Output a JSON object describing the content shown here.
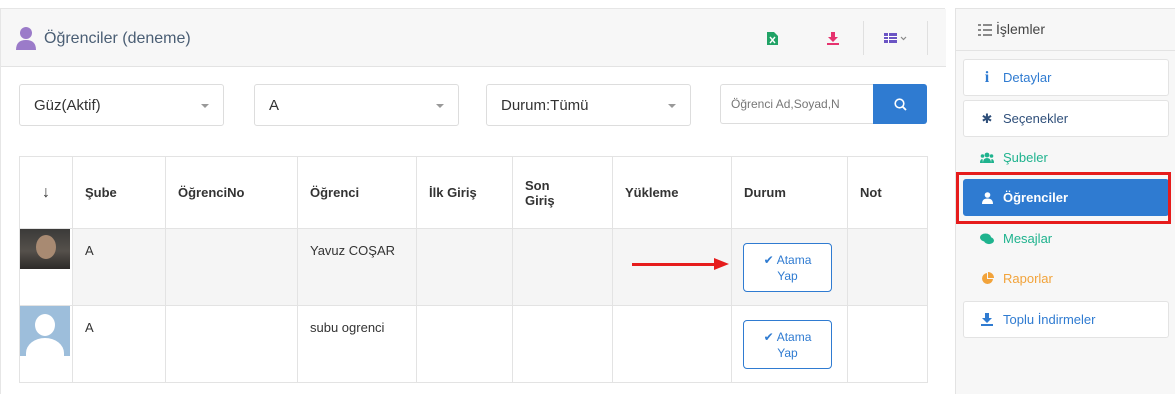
{
  "header": {
    "title": "Öğrenciler (deneme)",
    "user_icon": "user-icon",
    "buttons": [
      {
        "icon": "excel-export-icon",
        "color": "#21a366"
      },
      {
        "icon": "download-icon",
        "color": "#e6336f"
      },
      {
        "icon": "column-toggle-icon",
        "color": "#6b55c4"
      }
    ]
  },
  "filters": {
    "term": "Güz(Aktif)",
    "branch": "A",
    "status": "Durum:Tümü",
    "search_placeholder": "Öğrenci Ad,Soyad,N",
    "search_icon": "search-icon"
  },
  "table": {
    "sort_glyph": "↓",
    "columns": [
      "Şube",
      "ÖğrenciNo",
      "Öğrenci",
      "İlk Giriş",
      "Son\nGiriş",
      "Yükleme",
      "Durum",
      "Not"
    ],
    "rows": [
      {
        "photo": "student-photo",
        "sube": "A",
        "no": "",
        "name": "Yavuz COŞAR",
        "first_login": "",
        "last_login": "",
        "upload": "",
        "action_line1": "Atama",
        "action_line2": "Yap",
        "note": ""
      },
      {
        "photo": "default-avatar",
        "sube": "A",
        "no": "",
        "name": "subu ogrenci",
        "first_login": "",
        "last_login": "",
        "upload": "",
        "action_line1": "Atama",
        "action_line2": "Yap",
        "note": ""
      }
    ]
  },
  "side": {
    "title": "İşlemler",
    "items": [
      {
        "label": "Detaylar",
        "icon": "info-icon",
        "color": "#2f7bd1"
      },
      {
        "label": "Seçenekler",
        "icon": "cog-icon",
        "color": "#2f4f7a"
      },
      {
        "label": "Şubeler",
        "icon": "users-icon",
        "color": "#1fb38e"
      },
      {
        "label": "Öğrenciler",
        "icon": "user-icon",
        "color": "#ffffff",
        "active": true
      },
      {
        "label": "Mesajlar",
        "icon": "comments-icon",
        "color": "#1fb38e"
      },
      {
        "label": "Raporlar",
        "icon": "pie-chart-icon",
        "color": "#f2a33a"
      },
      {
        "label": "Toplu İndirmeler",
        "icon": "download-icon",
        "color": "#2f7bd1"
      }
    ]
  },
  "colors": {
    "accent": "#2f7bd1",
    "annotation_red": "#e61c1c"
  }
}
